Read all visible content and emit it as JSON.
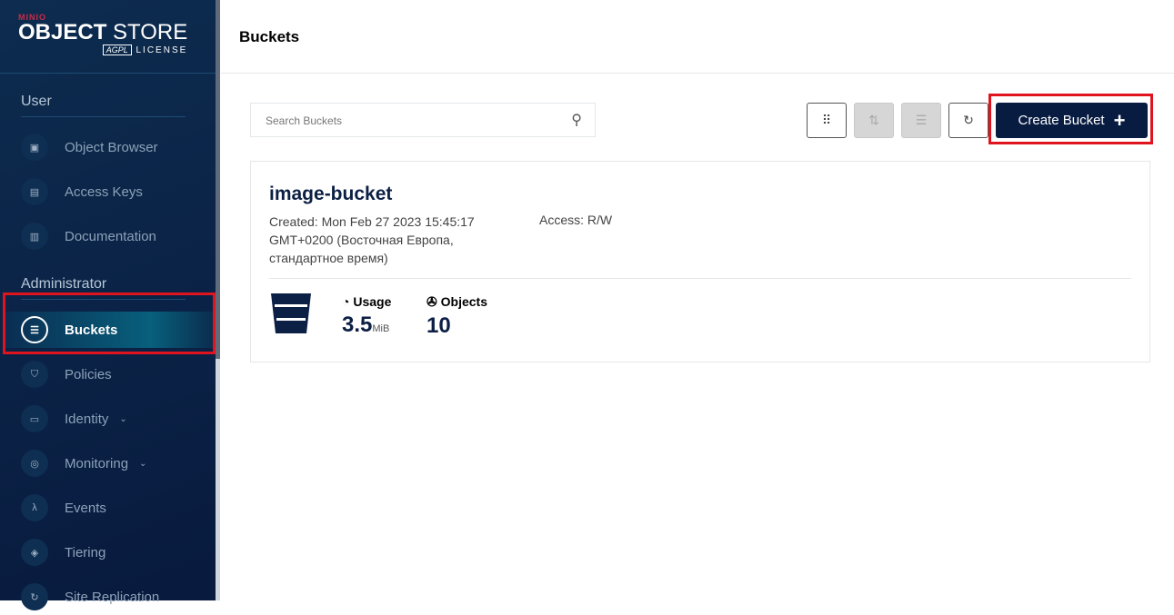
{
  "logo": {
    "brand": "MINIO",
    "product_bold": "OBJECT",
    "product_light": "STORE",
    "badge": "AGPL",
    "license": "LICENSE"
  },
  "sidebar": {
    "user_section": "User",
    "admin_section": "Administrator",
    "user_items": [
      {
        "label": "Object Browser",
        "icon": "▣"
      },
      {
        "label": "Access Keys",
        "icon": "▤"
      },
      {
        "label": "Documentation",
        "icon": "▥"
      }
    ],
    "admin_items": [
      {
        "label": "Buckets",
        "icon": "☰"
      },
      {
        "label": "Policies",
        "icon": "⛉"
      },
      {
        "label": "Identity",
        "icon": "▭"
      },
      {
        "label": "Monitoring",
        "icon": "◎"
      },
      {
        "label": "Events",
        "icon": "λ"
      },
      {
        "label": "Tiering",
        "icon": "◈"
      },
      {
        "label": "Site Replication",
        "icon": "↻"
      }
    ]
  },
  "header": {
    "title": "Buckets"
  },
  "search": {
    "placeholder": "Search Buckets"
  },
  "toolbar": {
    "create_label": "Create Bucket"
  },
  "bucket": {
    "name": "image-bucket",
    "created": "Created: Mon Feb 27 2023 15:45:17 GMT+0200 (Восточная Европа, стандартное время)",
    "access": "Access: R/W",
    "usage_label": "Usage",
    "usage_value": "3.5",
    "usage_unit": "MiB",
    "objects_label": "Objects",
    "objects_value": "10"
  }
}
